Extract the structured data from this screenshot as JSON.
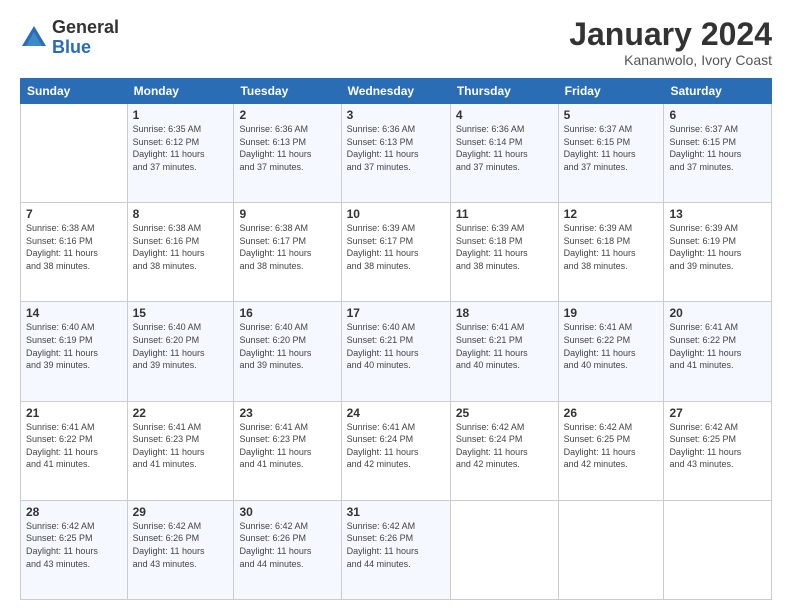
{
  "logo": {
    "general": "General",
    "blue": "Blue"
  },
  "header": {
    "month": "January 2024",
    "location": "Kananwolo, Ivory Coast"
  },
  "days_of_week": [
    "Sunday",
    "Monday",
    "Tuesday",
    "Wednesday",
    "Thursday",
    "Friday",
    "Saturday"
  ],
  "weeks": [
    [
      {
        "day": "",
        "sunrise": "",
        "sunset": "",
        "daylight": ""
      },
      {
        "day": "1",
        "sunrise": "Sunrise: 6:35 AM",
        "sunset": "Sunset: 6:12 PM",
        "daylight": "Daylight: 11 hours and 37 minutes."
      },
      {
        "day": "2",
        "sunrise": "Sunrise: 6:36 AM",
        "sunset": "Sunset: 6:13 PM",
        "daylight": "Daylight: 11 hours and 37 minutes."
      },
      {
        "day": "3",
        "sunrise": "Sunrise: 6:36 AM",
        "sunset": "Sunset: 6:13 PM",
        "daylight": "Daylight: 11 hours and 37 minutes."
      },
      {
        "day": "4",
        "sunrise": "Sunrise: 6:36 AM",
        "sunset": "Sunset: 6:14 PM",
        "daylight": "Daylight: 11 hours and 37 minutes."
      },
      {
        "day": "5",
        "sunrise": "Sunrise: 6:37 AM",
        "sunset": "Sunset: 6:15 PM",
        "daylight": "Daylight: 11 hours and 37 minutes."
      },
      {
        "day": "6",
        "sunrise": "Sunrise: 6:37 AM",
        "sunset": "Sunset: 6:15 PM",
        "daylight": "Daylight: 11 hours and 37 minutes."
      }
    ],
    [
      {
        "day": "7",
        "sunrise": "Sunrise: 6:38 AM",
        "sunset": "Sunset: 6:16 PM",
        "daylight": "Daylight: 11 hours and 38 minutes."
      },
      {
        "day": "8",
        "sunrise": "Sunrise: 6:38 AM",
        "sunset": "Sunset: 6:16 PM",
        "daylight": "Daylight: 11 hours and 38 minutes."
      },
      {
        "day": "9",
        "sunrise": "Sunrise: 6:38 AM",
        "sunset": "Sunset: 6:17 PM",
        "daylight": "Daylight: 11 hours and 38 minutes."
      },
      {
        "day": "10",
        "sunrise": "Sunrise: 6:39 AM",
        "sunset": "Sunset: 6:17 PM",
        "daylight": "Daylight: 11 hours and 38 minutes."
      },
      {
        "day": "11",
        "sunrise": "Sunrise: 6:39 AM",
        "sunset": "Sunset: 6:18 PM",
        "daylight": "Daylight: 11 hours and 38 minutes."
      },
      {
        "day": "12",
        "sunrise": "Sunrise: 6:39 AM",
        "sunset": "Sunset: 6:18 PM",
        "daylight": "Daylight: 11 hours and 38 minutes."
      },
      {
        "day": "13",
        "sunrise": "Sunrise: 6:39 AM",
        "sunset": "Sunset: 6:19 PM",
        "daylight": "Daylight: 11 hours and 39 minutes."
      }
    ],
    [
      {
        "day": "14",
        "sunrise": "Sunrise: 6:40 AM",
        "sunset": "Sunset: 6:19 PM",
        "daylight": "Daylight: 11 hours and 39 minutes."
      },
      {
        "day": "15",
        "sunrise": "Sunrise: 6:40 AM",
        "sunset": "Sunset: 6:20 PM",
        "daylight": "Daylight: 11 hours and 39 minutes."
      },
      {
        "day": "16",
        "sunrise": "Sunrise: 6:40 AM",
        "sunset": "Sunset: 6:20 PM",
        "daylight": "Daylight: 11 hours and 39 minutes."
      },
      {
        "day": "17",
        "sunrise": "Sunrise: 6:40 AM",
        "sunset": "Sunset: 6:21 PM",
        "daylight": "Daylight: 11 hours and 40 minutes."
      },
      {
        "day": "18",
        "sunrise": "Sunrise: 6:41 AM",
        "sunset": "Sunset: 6:21 PM",
        "daylight": "Daylight: 11 hours and 40 minutes."
      },
      {
        "day": "19",
        "sunrise": "Sunrise: 6:41 AM",
        "sunset": "Sunset: 6:22 PM",
        "daylight": "Daylight: 11 hours and 40 minutes."
      },
      {
        "day": "20",
        "sunrise": "Sunrise: 6:41 AM",
        "sunset": "Sunset: 6:22 PM",
        "daylight": "Daylight: 11 hours and 41 minutes."
      }
    ],
    [
      {
        "day": "21",
        "sunrise": "Sunrise: 6:41 AM",
        "sunset": "Sunset: 6:22 PM",
        "daylight": "Daylight: 11 hours and 41 minutes."
      },
      {
        "day": "22",
        "sunrise": "Sunrise: 6:41 AM",
        "sunset": "Sunset: 6:23 PM",
        "daylight": "Daylight: 11 hours and 41 minutes."
      },
      {
        "day": "23",
        "sunrise": "Sunrise: 6:41 AM",
        "sunset": "Sunset: 6:23 PM",
        "daylight": "Daylight: 11 hours and 41 minutes."
      },
      {
        "day": "24",
        "sunrise": "Sunrise: 6:41 AM",
        "sunset": "Sunset: 6:24 PM",
        "daylight": "Daylight: 11 hours and 42 minutes."
      },
      {
        "day": "25",
        "sunrise": "Sunrise: 6:42 AM",
        "sunset": "Sunset: 6:24 PM",
        "daylight": "Daylight: 11 hours and 42 minutes."
      },
      {
        "day": "26",
        "sunrise": "Sunrise: 6:42 AM",
        "sunset": "Sunset: 6:25 PM",
        "daylight": "Daylight: 11 hours and 42 minutes."
      },
      {
        "day": "27",
        "sunrise": "Sunrise: 6:42 AM",
        "sunset": "Sunset: 6:25 PM",
        "daylight": "Daylight: 11 hours and 43 minutes."
      }
    ],
    [
      {
        "day": "28",
        "sunrise": "Sunrise: 6:42 AM",
        "sunset": "Sunset: 6:25 PM",
        "daylight": "Daylight: 11 hours and 43 minutes."
      },
      {
        "day": "29",
        "sunrise": "Sunrise: 6:42 AM",
        "sunset": "Sunset: 6:26 PM",
        "daylight": "Daylight: 11 hours and 43 minutes."
      },
      {
        "day": "30",
        "sunrise": "Sunrise: 6:42 AM",
        "sunset": "Sunset: 6:26 PM",
        "daylight": "Daylight: 11 hours and 44 minutes."
      },
      {
        "day": "31",
        "sunrise": "Sunrise: 6:42 AM",
        "sunset": "Sunset: 6:26 PM",
        "daylight": "Daylight: 11 hours and 44 minutes."
      },
      {
        "day": "",
        "sunrise": "",
        "sunset": "",
        "daylight": ""
      },
      {
        "day": "",
        "sunrise": "",
        "sunset": "",
        "daylight": ""
      },
      {
        "day": "",
        "sunrise": "",
        "sunset": "",
        "daylight": ""
      }
    ]
  ]
}
